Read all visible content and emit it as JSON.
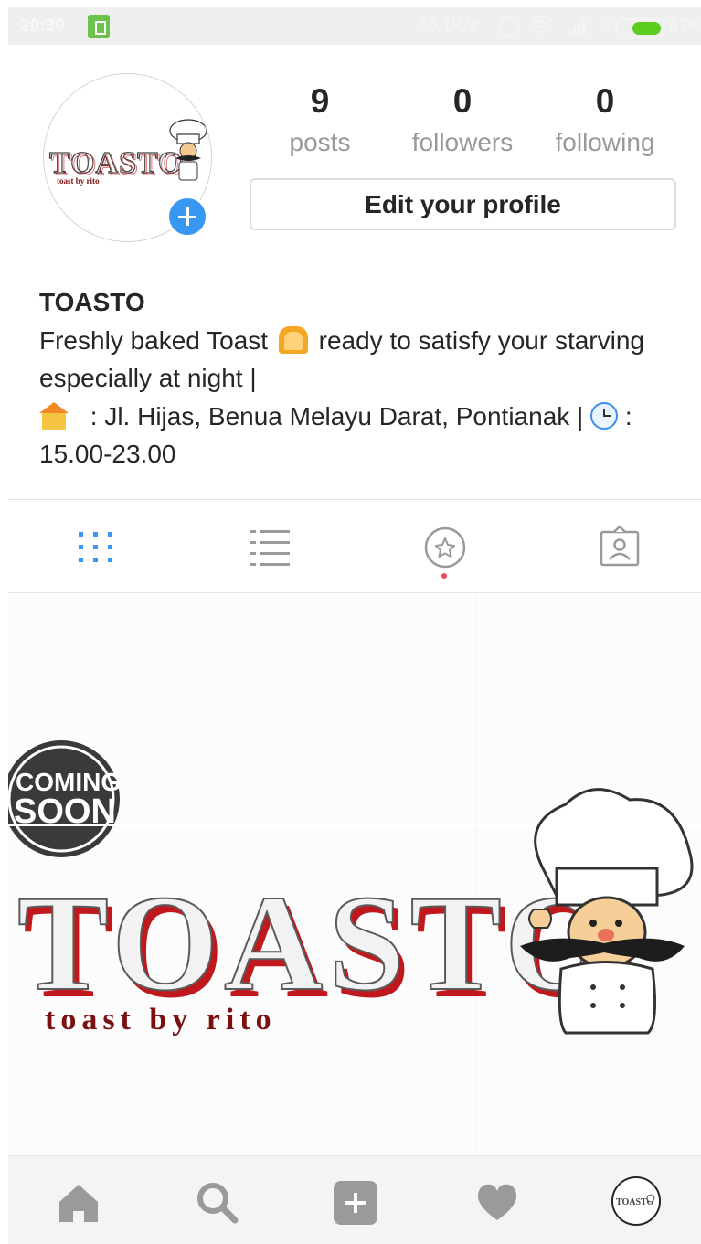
{
  "status_bar": {
    "time": "20:30",
    "network_speed": "40.1K/s",
    "battery_percent": "67%",
    "battery_level": 0.67,
    "icons": [
      "battery-saver-icon",
      "alarm-icon",
      "wifi-icon",
      "signal-icon",
      "charging-icon",
      "battery-icon"
    ]
  },
  "profile": {
    "avatar_text": "TOASTO",
    "avatar_subtext": "toast by rito",
    "stats": [
      {
        "value": "9",
        "label": "posts"
      },
      {
        "value": "0",
        "label": "followers"
      },
      {
        "value": "0",
        "label": "following"
      }
    ],
    "edit_button_label": "Edit your profile",
    "name": "TOASTO",
    "bio": {
      "line1_before": "Freshly baked Toast ",
      "line1_after": " ready to satisfy your starving",
      "line2": "especially at night |",
      "line3_address": " : Jl. Hijas,  Benua Melayu Darat, Pontianak | ",
      "line3_end": " :",
      "line4": "15.00-23.00"
    }
  },
  "tabs": [
    {
      "name": "grid-icon",
      "active": true
    },
    {
      "name": "list-icon",
      "active": false
    },
    {
      "name": "saved-star-icon",
      "active": false,
      "has_notification_dot": true
    },
    {
      "name": "tagged-icon",
      "active": false
    }
  ],
  "post_banner": {
    "badge_line1": "COMING",
    "badge_line2": "SOON",
    "brand": "TOASTO",
    "tagline": "toast by rito"
  },
  "bottom_nav": [
    {
      "name": "home-icon"
    },
    {
      "name": "search-icon"
    },
    {
      "name": "add-post-icon"
    },
    {
      "name": "activity-heart-icon"
    },
    {
      "name": "profile-avatar-icon"
    }
  ],
  "colors": {
    "accent_blue": "#3897f0",
    "battery_green": "#5ccc1f",
    "notification_red": "#ed4956",
    "brand_red": "#c0181d"
  }
}
